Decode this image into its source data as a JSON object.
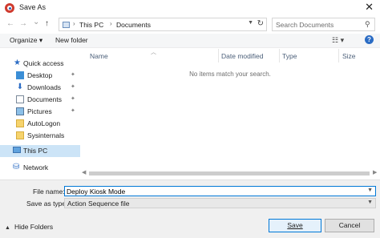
{
  "window": {
    "title": "Save As",
    "close_glyph": "✕"
  },
  "nav": {
    "back_glyph": "←",
    "forward_glyph": "→",
    "recent_glyph": "⌄",
    "up_glyph": "↑",
    "breadcrumb": [
      "This PC",
      "Documents"
    ],
    "separator": "›",
    "search_placeholder": "Search Documents"
  },
  "toolbar": {
    "organize_label": "Organize ▾",
    "new_folder_label": "New folder",
    "view_glyph": "☷ ▾",
    "help_glyph": "?"
  },
  "sidebar": {
    "items": [
      {
        "label": "Quick access",
        "icon": "star-icon",
        "pinned": false
      },
      {
        "label": "Desktop",
        "icon": "desktop-icon",
        "pinned": true
      },
      {
        "label": "Downloads",
        "icon": "download-icon",
        "pinned": true
      },
      {
        "label": "Documents",
        "icon": "documents-icon",
        "pinned": true
      },
      {
        "label": "Pictures",
        "icon": "pictures-icon",
        "pinned": true
      },
      {
        "label": "AutoLogon",
        "icon": "folder-icon",
        "pinned": false
      },
      {
        "label": "Sysinternals",
        "icon": "folder-icon",
        "pinned": false
      },
      {
        "label": "This PC",
        "icon": "computer-icon",
        "selected": true
      },
      {
        "label": "Network",
        "icon": "network-icon",
        "pinned": false
      }
    ],
    "pin_glyph": "📌"
  },
  "file_list": {
    "columns": [
      "Name",
      "Date modified",
      "Type",
      "Size"
    ],
    "empty_message": "No items match your search."
  },
  "form": {
    "file_name_label": "File name:",
    "file_name_value": "Deploy Kiosk Mode",
    "save_type_label": "Save as type:",
    "save_type_value": "Action Sequence file"
  },
  "footer": {
    "hide_folders_label": "Hide Folders",
    "save_label": "Save",
    "cancel_label": "Cancel"
  }
}
